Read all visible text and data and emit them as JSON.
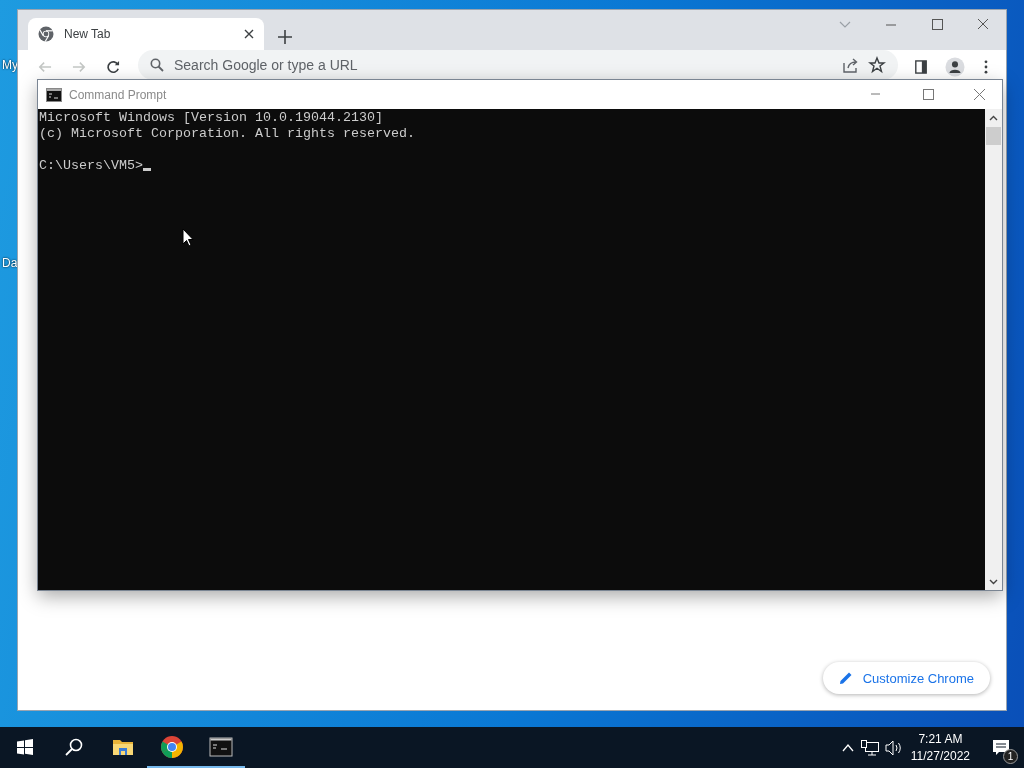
{
  "desktop_icons": [
    {
      "label": "My"
    },
    {
      "label": "Da"
    }
  ],
  "browser": {
    "tabs": [
      {
        "label": "New Tab",
        "selected": true
      }
    ],
    "address_bar": {
      "placeholder": "Search Google or type a URL"
    },
    "customize_button": "Customize Chrome"
  },
  "command_prompt": {
    "title": "Command Prompt",
    "lines": [
      "Microsoft Windows [Version 10.0.19044.2130]",
      "(c) Microsoft Corporation. All rights reserved."
    ],
    "prompt": "C:\\Users\\VM5>"
  },
  "taskbar": {
    "apps": [
      {
        "kind": "start",
        "running": false
      },
      {
        "kind": "search",
        "running": false
      },
      {
        "kind": "explorer",
        "running": false
      },
      {
        "kind": "chrome",
        "running": true
      },
      {
        "kind": "terminal",
        "running": true
      }
    ],
    "time": "7:21 AM",
    "date": "11/27/2022",
    "notifications": "1"
  }
}
